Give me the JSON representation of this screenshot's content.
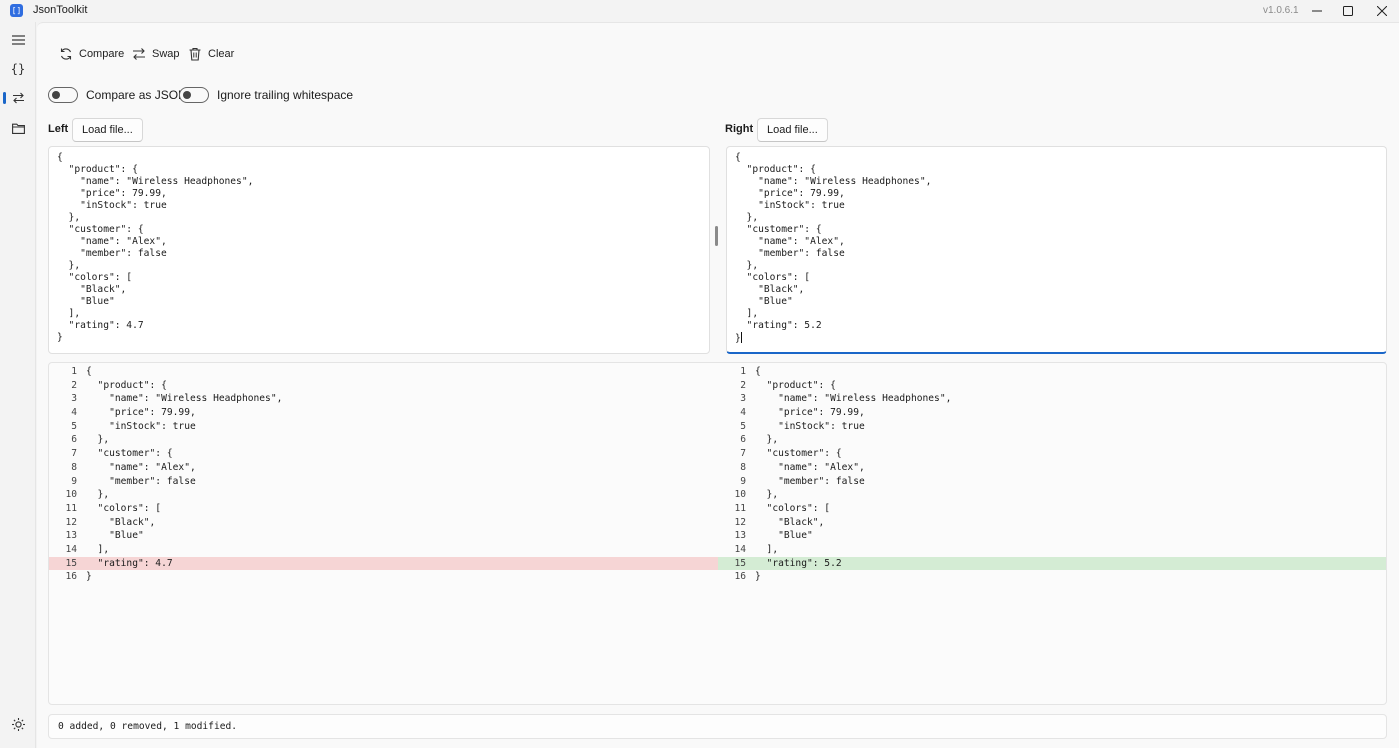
{
  "window": {
    "title": "JsonToolkit",
    "version": "v1.0.6.1",
    "icon_glyph": "[]"
  },
  "sidebar": {
    "items": [
      {
        "name": "menu",
        "icon": "hamburger-icon"
      },
      {
        "name": "json-formatter",
        "icon": "braces-icon",
        "glyph": "{}"
      },
      {
        "name": "compare",
        "icon": "swap-arrows-icon",
        "active": true
      },
      {
        "name": "files",
        "icon": "folder-icon"
      }
    ],
    "theme_icon": "sun-icon"
  },
  "toolbar": {
    "compare_label": "Compare",
    "swap_label": "Swap",
    "clear_label": "Clear"
  },
  "options": {
    "compare_as_json_label": "Compare as JSON",
    "compare_as_json_on": false,
    "ignore_ws_label": "Ignore trailing whitespace",
    "ignore_ws_on": false
  },
  "left": {
    "label": "Left",
    "load_label": "Load file...",
    "text": "{\n  \"product\": {\n    \"name\": \"Wireless Headphones\",\n    \"price\": 79.99,\n    \"inStock\": true\n  },\n  \"customer\": {\n    \"name\": \"Alex\",\n    \"member\": false\n  },\n  \"colors\": [\n    \"Black\",\n    \"Blue\"\n  ],\n  \"rating\": 4.7\n}"
  },
  "right": {
    "label": "Right",
    "load_label": "Load file...",
    "text": "{\n  \"product\": {\n    \"name\": \"Wireless Headphones\",\n    \"price\": 79.99,\n    \"inStock\": true\n  },\n  \"customer\": {\n    \"name\": \"Alex\",\n    \"member\": false\n  },\n  \"colors\": [\n    \"Black\",\n    \"Blue\"\n  ],\n  \"rating\": 5.2\n}"
  },
  "diff": {
    "left": [
      {
        "n": "1",
        "t": "{"
      },
      {
        "n": "2",
        "t": "  \"product\": {"
      },
      {
        "n": "3",
        "t": "    \"name\": \"Wireless Headphones\","
      },
      {
        "n": "4",
        "t": "    \"price\": 79.99,"
      },
      {
        "n": "5",
        "t": "    \"inStock\": true"
      },
      {
        "n": "6",
        "t": "  },"
      },
      {
        "n": "7",
        "t": "  \"customer\": {"
      },
      {
        "n": "8",
        "t": "    \"name\": \"Alex\","
      },
      {
        "n": "9",
        "t": "    \"member\": false"
      },
      {
        "n": "10",
        "t": "  },"
      },
      {
        "n": "11",
        "t": "  \"colors\": ["
      },
      {
        "n": "12",
        "t": "    \"Black\","
      },
      {
        "n": "13",
        "t": "    \"Blue\""
      },
      {
        "n": "14",
        "t": "  ],"
      },
      {
        "n": "15",
        "t": "  \"rating\": 4.7",
        "state": "removed"
      },
      {
        "n": "16",
        "t": "}"
      }
    ],
    "right": [
      {
        "n": "1",
        "t": "{"
      },
      {
        "n": "2",
        "t": "  \"product\": {"
      },
      {
        "n": "3",
        "t": "    \"name\": \"Wireless Headphones\","
      },
      {
        "n": "4",
        "t": "    \"price\": 79.99,"
      },
      {
        "n": "5",
        "t": "    \"inStock\": true"
      },
      {
        "n": "6",
        "t": "  },"
      },
      {
        "n": "7",
        "t": "  \"customer\": {"
      },
      {
        "n": "8",
        "t": "    \"name\": \"Alex\","
      },
      {
        "n": "9",
        "t": "    \"member\": false"
      },
      {
        "n": "10",
        "t": "  },"
      },
      {
        "n": "11",
        "t": "  \"colors\": ["
      },
      {
        "n": "12",
        "t": "    \"Black\","
      },
      {
        "n": "13",
        "t": "    \"Blue\""
      },
      {
        "n": "14",
        "t": "  ],"
      },
      {
        "n": "15",
        "t": "  \"rating\": 5.2",
        "state": "added"
      },
      {
        "n": "16",
        "t": "}"
      }
    ],
    "colors": {
      "removed": "#f6d5d5",
      "added": "#d4ecd4"
    }
  },
  "status": {
    "summary": "0 added, 0 removed, 1 modified."
  },
  "accent": "#1a66c8"
}
